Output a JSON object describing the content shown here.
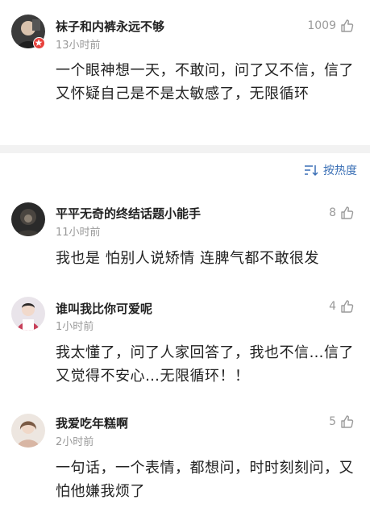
{
  "comments": [
    {
      "username": "袜子和内裤永远不够",
      "time": "13小时前",
      "likes": "1009",
      "text": "一个眼神想一天，不敢问，问了又不信，信了又怀疑自己是不是太敏感了，无限循环",
      "verified": true
    },
    {
      "username": "平平无奇的终结话题小能手",
      "time": "11小时前",
      "likes": "8",
      "text": "我也是 怕别人说矫情 连脾气都不敢很发"
    },
    {
      "username": "谁叫我比你可爱呢",
      "time": "1小时前",
      "likes": "4",
      "text": "我太懂了，问了人家回答了，我也不信…信了又觉得不安心…无限循环！！"
    },
    {
      "username": "我爱吃年糕啊",
      "time": "2小时前",
      "likes": "5",
      "text": "一句话，一个表情，都想问，时时刻刻问，又怕他嫌我烦了"
    }
  ],
  "sort": {
    "label": "按热度",
    "icon": "sort-icon"
  },
  "colors": {
    "accent": "#3a6fb5",
    "badge": "#e8413c",
    "muted": "#9a9a9a",
    "divider": "#f2f2f2"
  }
}
